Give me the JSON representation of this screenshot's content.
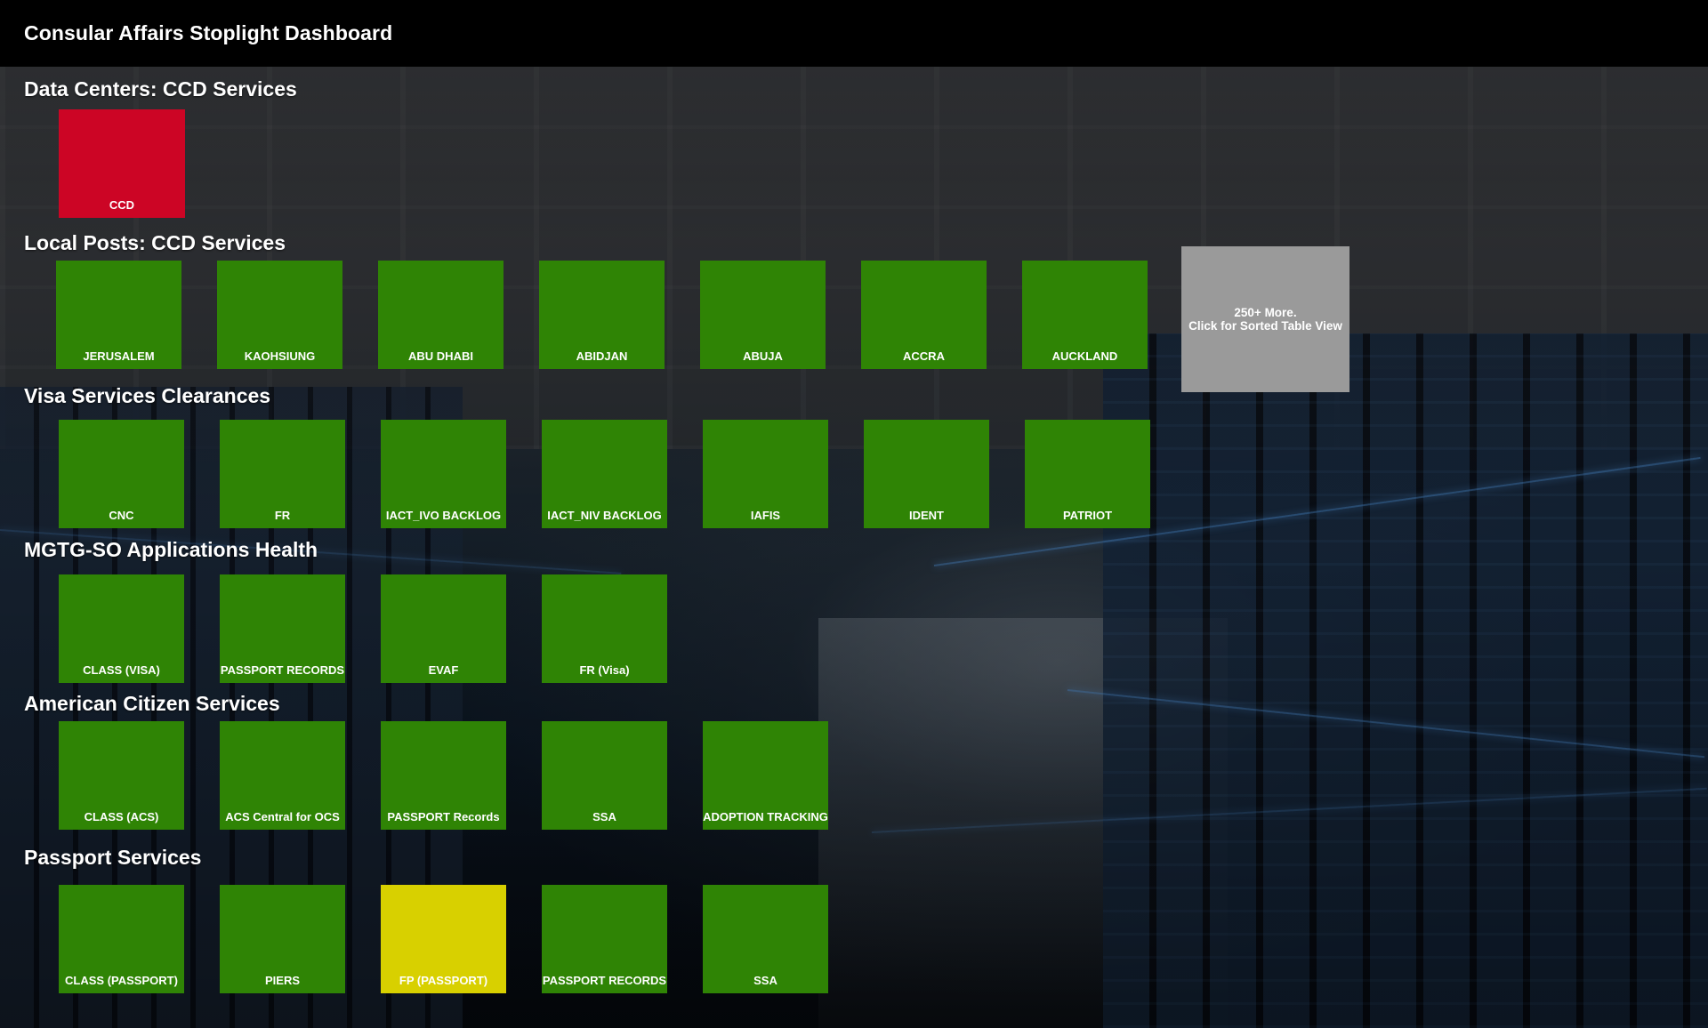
{
  "header": {
    "title": "Consular Affairs Stoplight Dashboard"
  },
  "colors": {
    "green": "#2f8405",
    "red": "#cc0525",
    "yellow": "#d8d000",
    "grey": "#9a9a9a"
  },
  "sections": {
    "data_centers": {
      "title": "Data Centers: CCD Services",
      "tiles": [
        {
          "label": "CCD",
          "status": "red"
        }
      ]
    },
    "local_posts": {
      "title": "Local Posts: CCD Services",
      "tiles": [
        {
          "label": "JERUSALEM",
          "status": "green"
        },
        {
          "label": "KAOHSIUNG",
          "status": "green"
        },
        {
          "label": "ABU DHABI",
          "status": "green"
        },
        {
          "label": "ABIDJAN",
          "status": "green"
        },
        {
          "label": "ABUJA",
          "status": "green"
        },
        {
          "label": "ACCRA",
          "status": "green"
        },
        {
          "label": "AUCKLAND",
          "status": "green"
        }
      ],
      "more": {
        "line1": "250+ More.",
        "line2": "Click for Sorted Table View"
      }
    },
    "visa": {
      "title": "Visa Services Clearances",
      "tiles": [
        {
          "label": "CNC",
          "status": "green"
        },
        {
          "label": "FR",
          "status": "green"
        },
        {
          "label": "IACT_IVO BACKLOG",
          "status": "green"
        },
        {
          "label": "IACT_NIV BACKLOG",
          "status": "green"
        },
        {
          "label": "IAFIS",
          "status": "green"
        },
        {
          "label": "IDENT",
          "status": "green"
        },
        {
          "label": "PATRIOT",
          "status": "green"
        }
      ]
    },
    "mgtg": {
      "title": "MGTG-SO Applications Health",
      "tiles": [
        {
          "label": "CLASS (VISA)",
          "status": "green"
        },
        {
          "label": "PASSPORT RECORDS",
          "status": "green"
        },
        {
          "label": "EVAF",
          "status": "green"
        },
        {
          "label": "FR (Visa)",
          "status": "green"
        }
      ]
    },
    "acs": {
      "title": "American Citizen Services",
      "tiles": [
        {
          "label": "CLASS (ACS)",
          "status": "green"
        },
        {
          "label": "ACS Central for OCS",
          "status": "green"
        },
        {
          "label": "PASSPORT Records",
          "status": "green"
        },
        {
          "label": "SSA",
          "status": "green"
        },
        {
          "label": "ADOPTION TRACKING",
          "status": "green"
        }
      ]
    },
    "passport": {
      "title": "Passport Services",
      "tiles": [
        {
          "label": "CLASS (PASSPORT)",
          "status": "green"
        },
        {
          "label": "PIERS",
          "status": "green"
        },
        {
          "label": "FP (PASSPORT)",
          "status": "yellow"
        },
        {
          "label": "PASSPORT RECORDS",
          "status": "green"
        },
        {
          "label": "SSA",
          "status": "green"
        }
      ]
    }
  }
}
